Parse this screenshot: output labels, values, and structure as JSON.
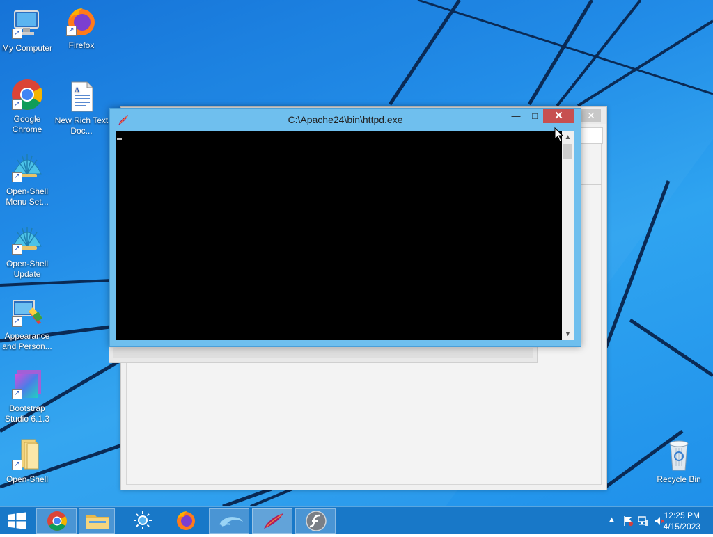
{
  "desktop": {
    "icons": [
      {
        "label": "My Computer",
        "icon": "computer-icon"
      },
      {
        "label": "Firefox",
        "icon": "firefox-icon"
      },
      {
        "label": "Google Chrome",
        "icon": "chrome-icon"
      },
      {
        "label": "New Rich Text Doc...",
        "icon": "rich-text-document-icon"
      },
      {
        "label": "Open-Shell Menu Set...",
        "icon": "open-shell-icon"
      },
      {
        "label": "Open-Shell Update",
        "icon": "open-shell-icon"
      },
      {
        "label": "Appearance and Person...",
        "icon": "appearance-icon"
      },
      {
        "label": "Bootstrap Studio 6.1.3",
        "icon": "bootstrap-studio-icon"
      },
      {
        "label": "Open-Shell",
        "icon": "folder-icon"
      },
      {
        "label": "Recycle Bin",
        "icon": "recycle-bin-icon"
      }
    ]
  },
  "console_window": {
    "title": "C:\\Apache24\\bin\\httpd.exe",
    "icon": "apache-feather-icon",
    "minimize_label": "—",
    "maximize_label": "□",
    "close_label": "✕",
    "background_color": "#000000",
    "frame_color": "#6fbfee",
    "close_color": "#c75050"
  },
  "taskbar": {
    "start_icon": "windows-logo-icon",
    "items": [
      {
        "name": "chrome",
        "icon": "chrome-icon"
      },
      {
        "name": "file-explorer",
        "icon": "folder-icon"
      },
      {
        "name": "weather",
        "icon": "sun-icon"
      },
      {
        "name": "firefox",
        "icon": "firefox-icon"
      },
      {
        "name": "dolphin",
        "icon": "dolphin-icon"
      },
      {
        "name": "apache",
        "icon": "apache-feather-icon"
      },
      {
        "name": "flash",
        "icon": "flash-icon"
      }
    ],
    "tray": {
      "chevron": "▲",
      "icons": [
        "action-center-flag-icon",
        "network-icon",
        "volume-muted-icon"
      ]
    },
    "clock": {
      "time": "12:25 PM",
      "date": "4/15/2023"
    },
    "color": "#1878c8"
  }
}
